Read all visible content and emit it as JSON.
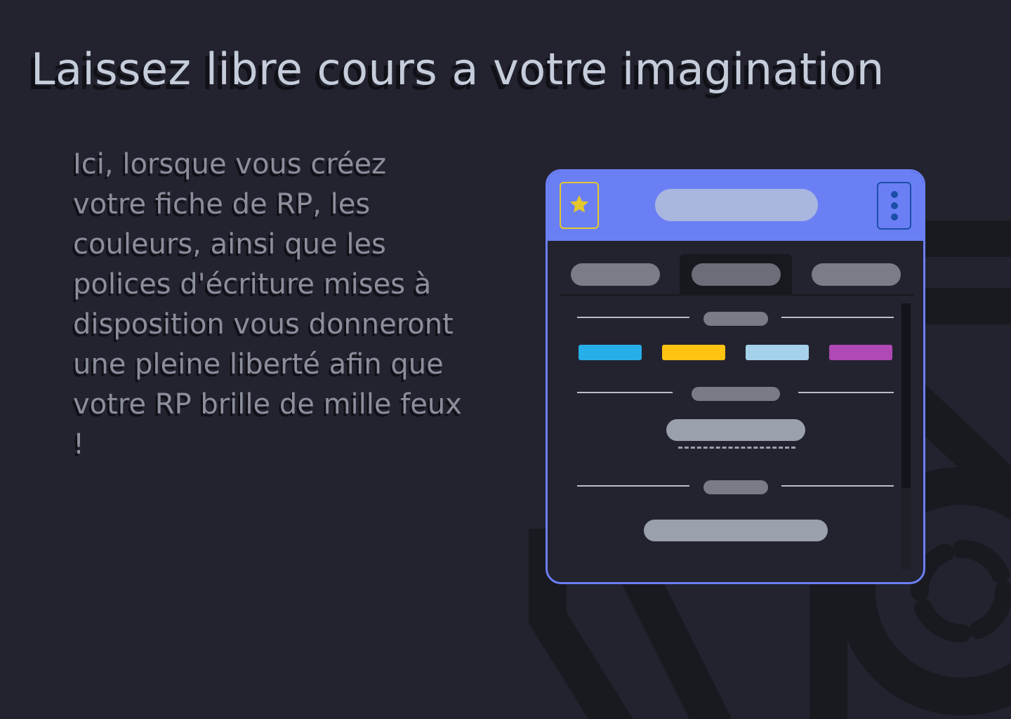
{
  "heading": "Laissez libre cours a votre imagination",
  "paragraph": "Ici, lorsque vous créez votre fiche de RP, les couleurs, ainsi que les polices d'écriture mises à disposition vous donneront une pleine liberté afin que votre RP brille de mille feux !",
  "colors": {
    "background": "#23232f",
    "accent": "#6b7ff5",
    "star": "#e3c72c",
    "menu": "#1b4fa8",
    "swatches": [
      "#26aee8",
      "#ffc312",
      "#a6d1ea",
      "#b048b5"
    ]
  },
  "mockup_card": {
    "icons": [
      "star-icon",
      "vertical-dots-icon"
    ],
    "tab_count": 3,
    "active_tab": 2
  }
}
